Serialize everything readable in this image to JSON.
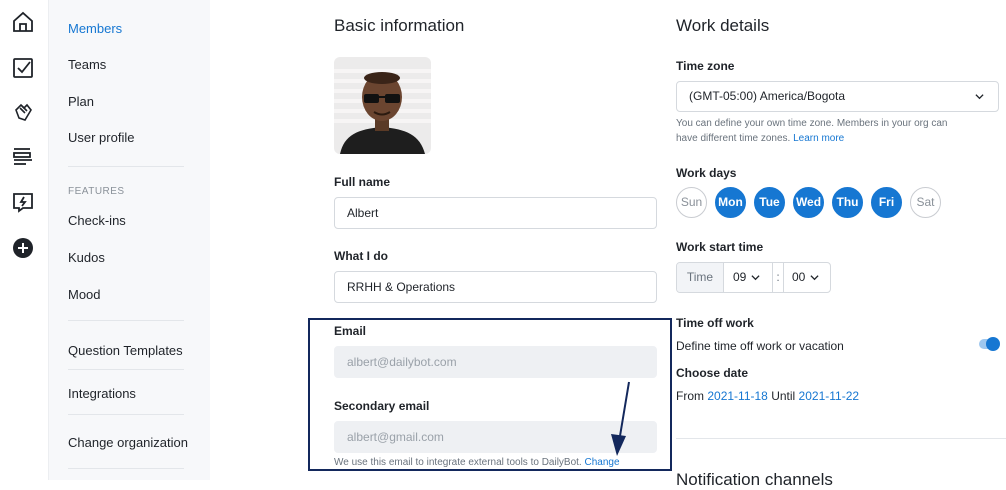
{
  "rail": {
    "icons": [
      "home-icon",
      "checkin-icon",
      "kudos-hands-icon",
      "reports-icon",
      "forms-icon",
      "add-icon"
    ]
  },
  "sidebar": {
    "items_top": [
      {
        "label": "Members",
        "active": true
      },
      {
        "label": "Teams"
      },
      {
        "label": "Plan"
      },
      {
        "label": "User profile"
      }
    ],
    "features_title": "FEATURES",
    "features": [
      {
        "label": "Check-ins"
      },
      {
        "label": "Kudos"
      },
      {
        "label": "Mood"
      }
    ],
    "question_templates": "Question Templates",
    "integrations": "Integrations",
    "change_org": "Change organization"
  },
  "basic": {
    "title": "Basic information",
    "full_name_label": "Full name",
    "full_name": "Albert",
    "what_label": "What I do",
    "what_value": "RRHH & Operations",
    "email_label": "Email",
    "email_value": "albert@dailybot.com",
    "secondary_label": "Secondary email",
    "secondary_value": "albert@gmail.com",
    "email_help": "We use this email to integrate external tools to DailyBot.",
    "change_link": "Change"
  },
  "work": {
    "title": "Work details",
    "tz_label": "Time zone",
    "tz_value": "(GMT-05:00) America/Bogota",
    "tz_help_1": "You can define your own time zone. Members in your org can",
    "tz_help_2": "have different time zones.",
    "learn_more": "Learn more",
    "days_label": "Work days",
    "days": [
      {
        "label": "Sun",
        "on": false
      },
      {
        "label": "Mon",
        "on": true
      },
      {
        "label": "Tue",
        "on": true
      },
      {
        "label": "Wed",
        "on": true
      },
      {
        "label": "Thu",
        "on": true
      },
      {
        "label": "Fri",
        "on": true
      },
      {
        "label": "Sat",
        "on": false
      }
    ],
    "start_label": "Work start time",
    "time_word": "Time",
    "hour": "09",
    "minute": "00",
    "colon": ":",
    "timeoff_label": "Time off work",
    "timeoff_desc": "Define time off work or vacation",
    "timeoff_enabled": true,
    "choose_date_label": "Choose date",
    "from_word": "From",
    "from_date": "2021-11-18",
    "until_word": "Until",
    "until_date": "2021-11-22",
    "next_section_partial": "Notification channels"
  },
  "colors": {
    "accent": "#1677d2",
    "highlight_border": "#13285c",
    "arrow": "#13285c"
  }
}
